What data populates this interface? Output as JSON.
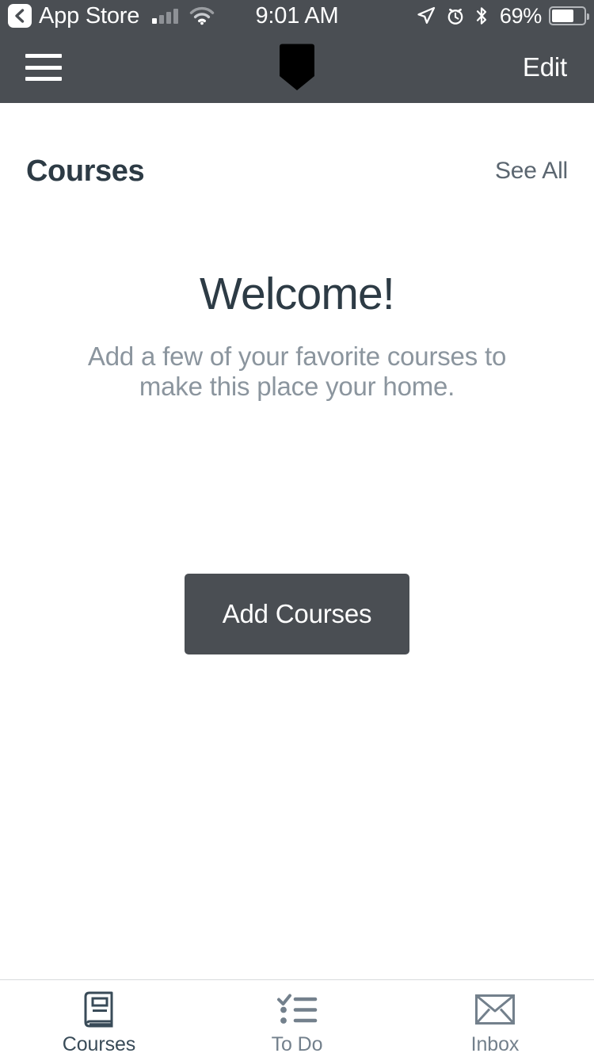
{
  "status_bar": {
    "back_chip_icon": "chevron-left-icon",
    "carrier": "App Store",
    "signal_icon": "cellular-signal-icon",
    "wifi_icon": "wifi-icon",
    "time": "9:01 AM",
    "location_icon": "location-arrow-icon",
    "alarm_icon": "alarm-clock-icon",
    "bluetooth_icon": "bluetooth-icon",
    "battery_percent": "69%",
    "battery_icon": "battery-icon",
    "battery_level": 69,
    "background_color": "#4a4e53"
  },
  "nav_bar": {
    "menu_icon": "hamburger-menu-icon",
    "logo_icon": "canvas-shield-logo-icon",
    "edit_label": "Edit",
    "background_color": "#4a4e53",
    "logo_color": "#000000"
  },
  "section": {
    "title": "Courses",
    "see_all_label": "See All",
    "title_color": "#2d3b45",
    "see_all_color": "#5b6670"
  },
  "empty_state": {
    "heading": "Welcome!",
    "subtext": "Add a few of your favorite courses to make this place your home.",
    "button_label": "Add Courses",
    "heading_color": "#2d3b45",
    "subtext_color": "#8b959e",
    "button_color": "#4a4e53"
  },
  "tab_bar": {
    "tabs": [
      {
        "label": "Courses",
        "icon": "book-icon",
        "active": true
      },
      {
        "label": "To Do",
        "icon": "checklist-icon",
        "active": false
      },
      {
        "label": "Inbox",
        "icon": "envelope-icon",
        "active": false
      }
    ],
    "active_color": "#394b58",
    "inactive_color": "#73808c"
  }
}
